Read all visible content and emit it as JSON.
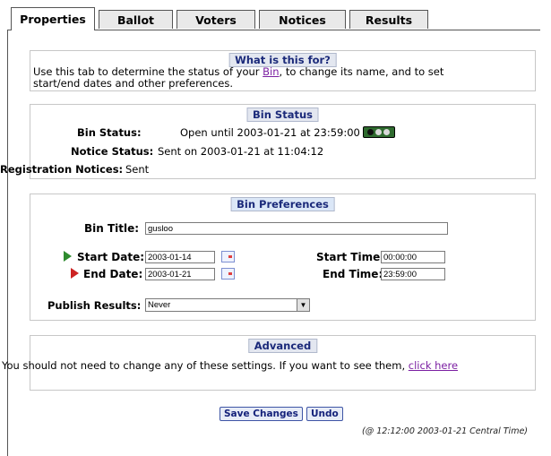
{
  "tabs": [
    {
      "label": "Properties",
      "active": true
    },
    {
      "label": "Ballot"
    },
    {
      "label": "Voters"
    },
    {
      "label": "Notices"
    },
    {
      "label": "Results"
    }
  ],
  "what_for": {
    "title": "What is this for?",
    "text_before": "Use this tab to determine the status of your ",
    "link": "Bin",
    "text_after": ", to change its name, and to set",
    "line2": "start/end dates and other preferences."
  },
  "bin_status": {
    "title": "Bin Status",
    "status_label": "Bin Status:",
    "status_value": "Open until 2003-01-21 at 23:59:00",
    "notice_label": "Notice Status:",
    "notice_value": "Sent on 2003-01-21 at 11:04:12",
    "registration_label": "Registration Notices:",
    "registration_value": "Sent",
    "light_colors": [
      "#111111",
      "#d8d8d8",
      "#d8d8d8"
    ]
  },
  "prefs": {
    "title": "Bin Preferences",
    "bin_title_label": "Bin Title:",
    "bin_title_value": "gusloo",
    "start_date_label": "Start Date:",
    "start_date_value": "2003-01-14",
    "end_date_label": "End Date:",
    "end_date_value": "2003-01-21",
    "start_time_label": "Start Time:",
    "start_time_value": "00:00:00",
    "end_time_label": "End Time:",
    "end_time_value": "23:59:00",
    "publish_label": "Publish Results:",
    "publish_value": "Never",
    "start_arrow_color": "#2e8b2e",
    "end_arrow_color": "#cc2222"
  },
  "advanced": {
    "title": "Advanced",
    "text": "You should not need to change any of these settings. If you want to see them,",
    "link": "click here"
  },
  "buttons": {
    "save": "Save Changes",
    "undo": "Undo"
  },
  "timestamp": "(@ 12:12:00 2003-01-21 Central Time)"
}
